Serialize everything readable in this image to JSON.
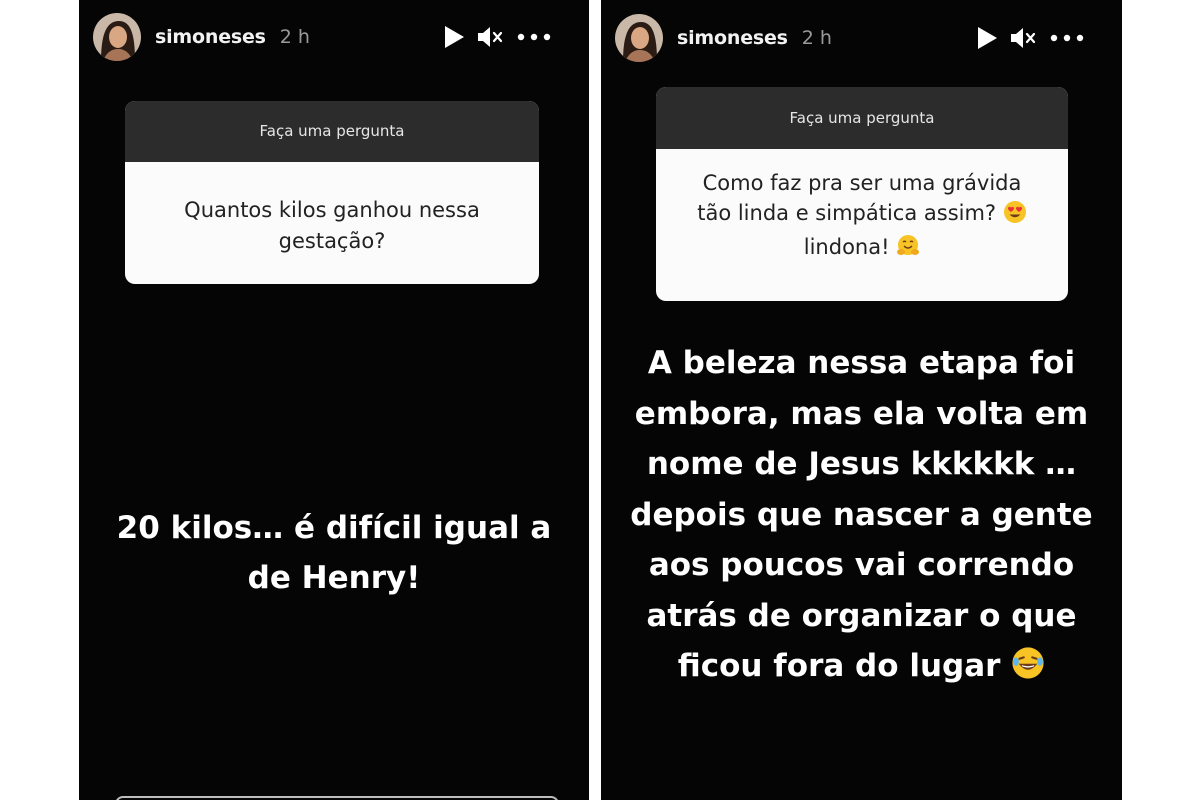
{
  "stories": [
    {
      "username": "simoneses",
      "time": "2 h",
      "question_sticker": {
        "header": "Faça uma pergunta",
        "question": "Quantos kilos ganhou nessa gestação?"
      },
      "answer": "20 kilos… é difícil igual a de Henry!"
    },
    {
      "username": "simoneses",
      "time": "2 h",
      "question_sticker": {
        "header": "Faça uma pergunta",
        "question_line1": "Como faz pra ser uma grávida",
        "question_line2": "tão linda e simpática assim?",
        "question_line3": "lindona!"
      },
      "answer": "A beleza nessa etapa foi embora, mas ela volta em nome de Jesus kkkkkk … depois que nascer a gente aos poucos vai correndo atrás de organizar o que ficou fora do lugar"
    }
  ],
  "icons": [
    "play-icon",
    "mute-icon",
    "more-icon",
    "heart-eyes-emoji-icon",
    "hug-emoji-icon",
    "laughing-tears-emoji-icon"
  ]
}
